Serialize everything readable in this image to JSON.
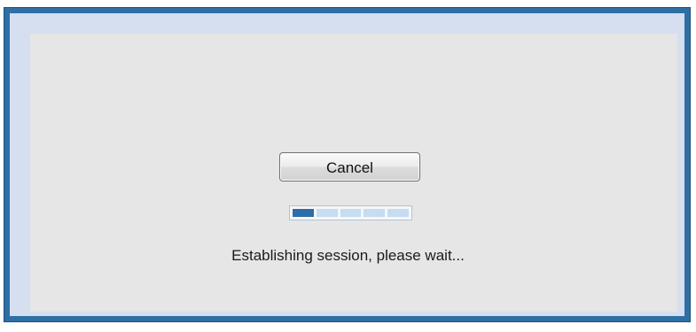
{
  "dialog": {
    "cancel_label": "Cancel",
    "status_text": "Establishing session, please wait...",
    "progress": {
      "segments_total": 5,
      "segments_active": 1,
      "active_color": "#2e6ea6",
      "inactive_color": "#c6dcf1"
    }
  },
  "colors": {
    "window_border": "#2f6fa4",
    "frame": "#d5dff0",
    "content_background": "#e6e6e6"
  }
}
